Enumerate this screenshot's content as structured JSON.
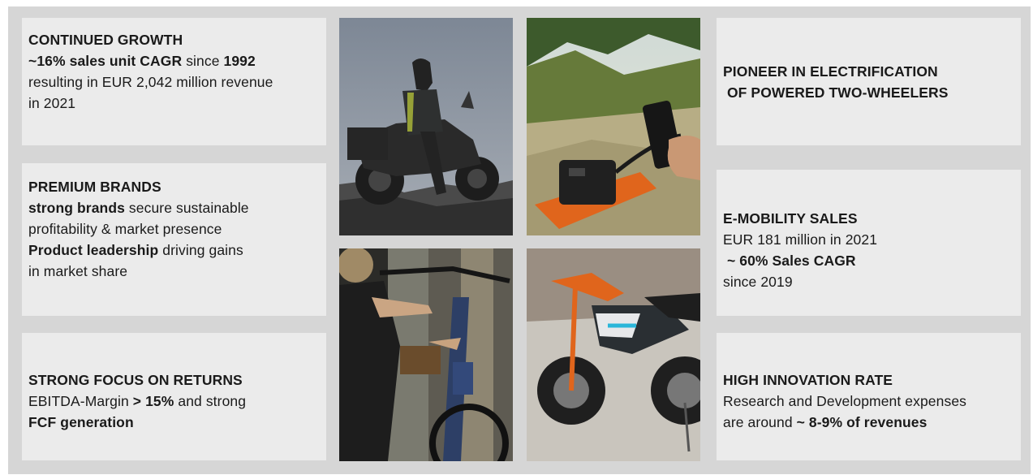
{
  "left": [
    {
      "title": "CONTINUED GROWTH",
      "lines": [
        [
          {
            "t": "~16% sales unit CAGR",
            "b": true
          },
          {
            "t": " since ",
            "b": false
          },
          {
            "t": "1992",
            "b": true
          }
        ],
        [
          {
            "t": "resulting in EUR 2,042 million revenue",
            "b": false
          }
        ],
        [
          {
            "t": "in 2021",
            "b": false
          }
        ]
      ]
    },
    {
      "title": "PREMIUM BRANDS",
      "lines": [
        [
          {
            "t": "strong brands",
            "b": true
          },
          {
            "t": " secure sustainable",
            "b": false
          }
        ],
        [
          {
            "t": "profitability & market presence",
            "b": false
          }
        ],
        [
          {
            "t": "Product leadership",
            "b": true
          },
          {
            "t": " driving gains",
            "b": false
          }
        ],
        [
          {
            "t": "in market share",
            "b": false
          }
        ]
      ]
    },
    {
      "title": "STRONG FOCUS ON RETURNS",
      "lines": [
        [
          {
            "t": "EBITDA-Margin ",
            "b": false
          },
          {
            "t": "> 15%",
            "b": true
          },
          {
            "t": " and strong",
            "b": false
          }
        ],
        [
          {
            "t": "FCF generation",
            "b": true
          }
        ]
      ]
    }
  ],
  "right": [
    {
      "title": "PIONEER IN ELECTRIFICATION",
      "title2": " OF POWERED TWO-WHEELERS",
      "lines": []
    },
    {
      "title": "E-MOBILITY SALES",
      "lines": [
        [
          {
            "t": "EUR 181 million in 2021",
            "b": false
          }
        ],
        [
          {
            "t": " ~ 60% Sales CAGR",
            "b": true
          }
        ],
        [
          {
            "t": "since 2019",
            "b": false
          }
        ]
      ]
    },
    {
      "title": "HIGH INNOVATION RATE",
      "lines": [
        [
          {
            "t": "Research and Development expenses",
            "b": false
          }
        ],
        [
          {
            "t": "are around ",
            "b": false
          },
          {
            "t": "~ 8-9% of revenues",
            "b": true
          }
        ]
      ]
    }
  ],
  "colors": {
    "background": "#d6d6d6",
    "card": "#ebebeb",
    "text": "#1a1a1a",
    "accent_orange": "#e0651c"
  }
}
